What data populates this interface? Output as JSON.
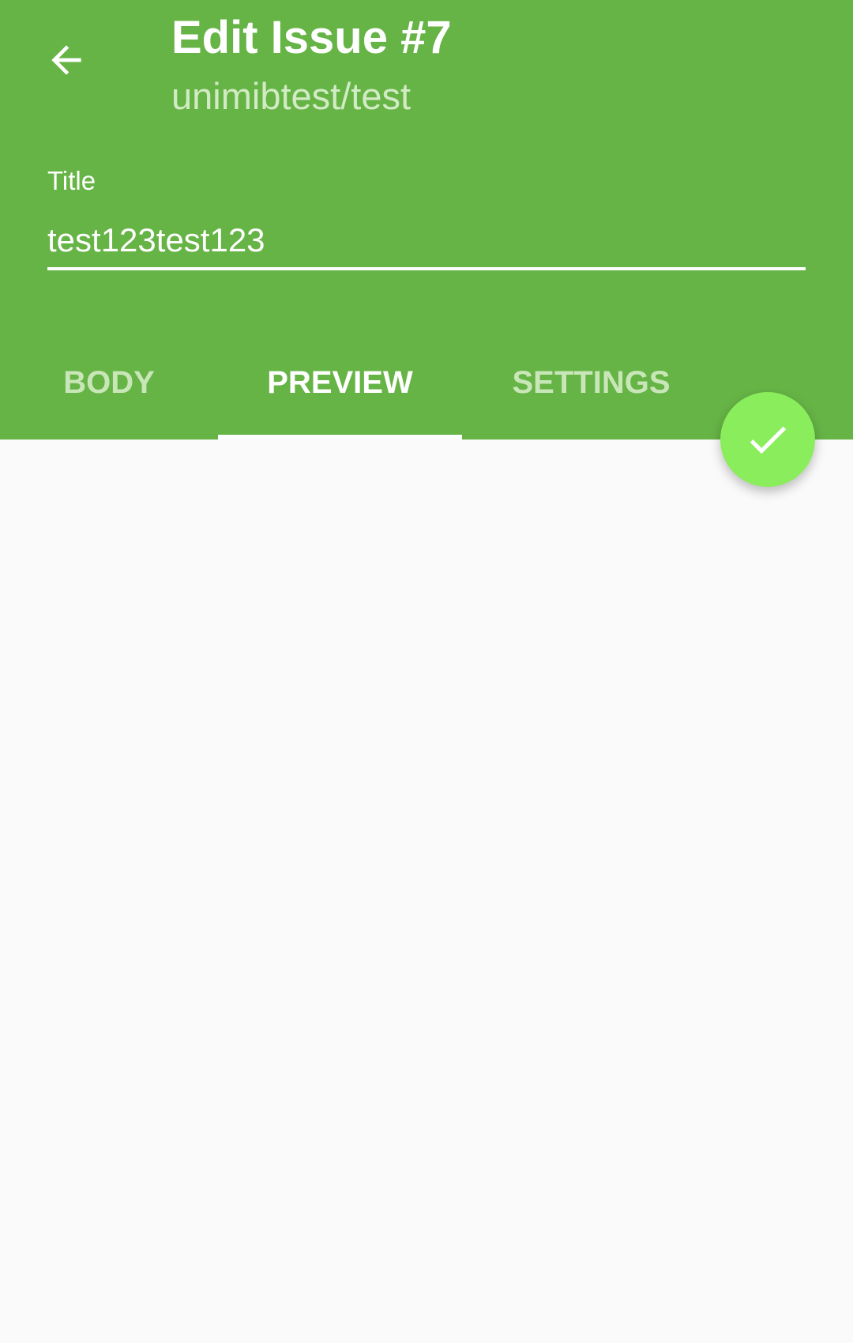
{
  "header": {
    "back_icon": "arrow-left-icon",
    "title": "Edit Issue #7",
    "subtitle": "unimibtest/test"
  },
  "form": {
    "title_label": "Title",
    "title_value": "test123test123"
  },
  "tabs": [
    {
      "label": "BODY",
      "active": false
    },
    {
      "label": "PREVIEW",
      "active": true
    },
    {
      "label": "SETTINGS",
      "active": false
    }
  ],
  "fab": {
    "icon": "check-icon"
  },
  "colors": {
    "primary": "#66b446",
    "accent": "#8aed5b",
    "background": "#fafafa",
    "subtitle": "#d2ebc5",
    "inactive_tab": "#c9e6b8"
  }
}
